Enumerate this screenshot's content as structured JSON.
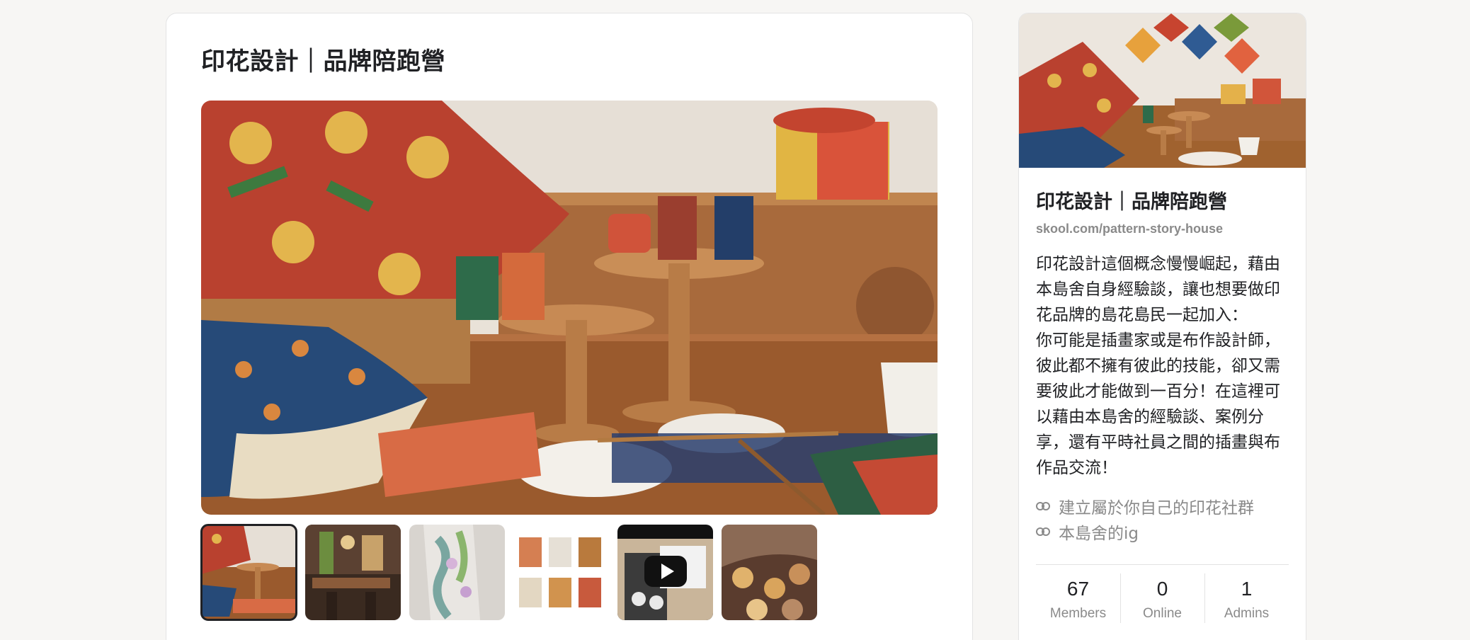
{
  "main": {
    "title": "印花設計｜品牌陪跑營",
    "thumbnails": [
      {
        "name": "thumb-living-room",
        "selected": true
      },
      {
        "name": "thumb-shop-interior",
        "selected": false
      },
      {
        "name": "thumb-fabric-sample",
        "selected": false
      },
      {
        "name": "thumb-product-grid",
        "selected": false
      },
      {
        "name": "thumb-video",
        "selected": false,
        "is_video": true
      },
      {
        "name": "thumb-pattern-closeup",
        "selected": false
      }
    ]
  },
  "sidebar": {
    "group_name": "印花設計｜品牌陪跑營",
    "url": "skool.com/pattern-story-house",
    "description": "印花設計這個概念慢慢崛起，藉由本島舍自身經驗談，讓也想要做印花品牌的島花島民一起加入：\n你可能是插畫家或是布作設計師，彼此都不擁有彼此的技能，卻又需要彼此才能做到一百分！在這裡可以藉由本島舍的經驗談、案例分享，還有平時社員之間的插畫與布作品交流！",
    "links": [
      {
        "label": "建立屬於你自己的印花社群",
        "icon": "link-icon"
      },
      {
        "label": "本島舍的ig",
        "icon": "link-icon"
      }
    ],
    "stats": [
      {
        "value": "67",
        "label": "Members"
      },
      {
        "value": "0",
        "label": "Online"
      },
      {
        "value": "1",
        "label": "Admins"
      }
    ]
  }
}
